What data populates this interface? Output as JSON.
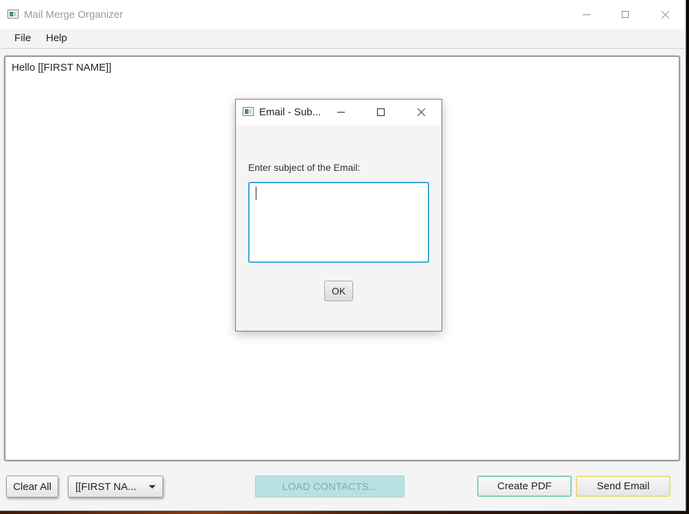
{
  "window": {
    "title": "Mail Merge Organizer"
  },
  "menubar": {
    "items": [
      "File",
      "Help"
    ]
  },
  "editor": {
    "content": "Hello [[FIRST NAME]]"
  },
  "toolbar": {
    "clear_all": "Clear All",
    "placeholder_combo_value": "[[FIRST NA...",
    "load_contacts": "LOAD CONTACTS...",
    "create_pdf": "Create PDF",
    "send_email": "Send Email"
  },
  "dialog": {
    "title": "Email - Sub...",
    "prompt": "Enter subject of the Email:",
    "input_value": "",
    "ok_label": "OK"
  },
  "colors": {
    "load_contacts_bg": "#b8e2e2",
    "create_pdf_border": "#7fd6a8",
    "send_email_border": "#e6e07a",
    "input_focus_border": "#3aa7d6"
  }
}
